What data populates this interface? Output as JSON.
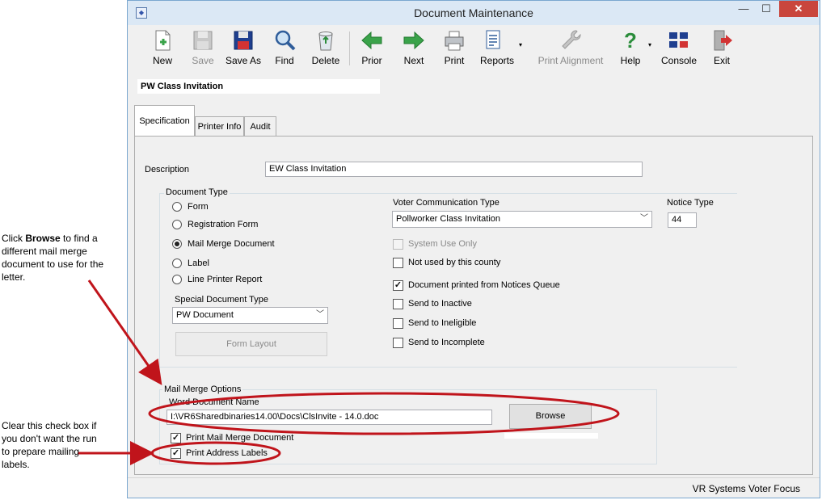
{
  "callouts": {
    "browse": {
      "pre": "Click ",
      "bold": "Browse",
      "post": " to find a different mail merge document to use for the letter."
    },
    "labels": "Clear this check box if you don't want the run to prepare mailing labels."
  },
  "window": {
    "title": "Document Maintenance",
    "minimize": "—",
    "maximize": "☐",
    "close": "✕"
  },
  "toolbar": {
    "new": "New",
    "save": "Save",
    "save_as": "Save As",
    "find": "Find",
    "delete": "Delete",
    "prior": "Prior",
    "next": "Next",
    "print": "Print",
    "reports": "Reports",
    "print_alignment": "Print Alignment",
    "help": "Help",
    "console": "Console",
    "exit": "Exit"
  },
  "record_name": "PW Class Invitation",
  "tabs": [
    "Specification",
    "Printer Info",
    "Audit"
  ],
  "spec": {
    "description_label": "Description",
    "description_value": "EW Class Invitation",
    "document_type_label": "Document Type",
    "document_types": [
      "Form",
      "Registration Form",
      "Mail Merge Document",
      "Label",
      "Line Printer Report"
    ],
    "selected_type_index": 2,
    "special_type_label": "Special Document Type",
    "special_type_value": "PW Document",
    "form_layout_button": "Form Layout",
    "voter_comm_label": "Voter Communication Type",
    "voter_comm_value": "Pollworker Class Invitation",
    "notice_type_label": "Notice Type",
    "notice_type_value": "44",
    "checks": [
      {
        "label": "System Use Only",
        "checked": false,
        "disabled": true
      },
      {
        "label": "Not used by this county",
        "checked": false,
        "disabled": false
      },
      {
        "label": "Document printed from Notices Queue",
        "checked": true,
        "disabled": false
      },
      {
        "label": "Send to Inactive",
        "checked": false,
        "disabled": false
      },
      {
        "label": "Send to Ineligible",
        "checked": false,
        "disabled": false
      },
      {
        "label": "Send to Incomplete",
        "checked": false,
        "disabled": false
      }
    ],
    "mail_merge_label": "Mail Merge Options",
    "word_doc_label": "Word Document Name",
    "word_doc_value": "I:\\VR6Sharedbinaries14.00\\Docs\\ClsInvite - 14.0.doc",
    "browse_button": "Browse",
    "print_merge_label": "Print Mail Merge Document",
    "print_merge_checked": true,
    "print_labels_label": "Print Address Labels",
    "print_labels_checked": true
  },
  "status_text": "VR Systems Voter Focus",
  "colors": {
    "annotation": "#c0141b",
    "titlebar": "#dbe8f5",
    "close": "#c9463d",
    "accent_green": "#3aa34a"
  }
}
